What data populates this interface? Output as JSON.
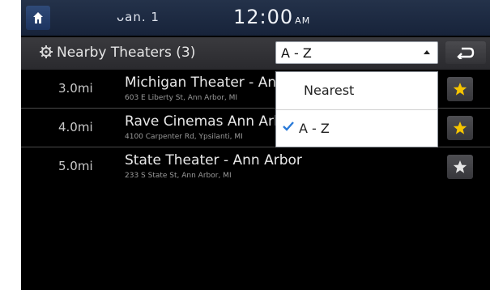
{
  "status_bar": {
    "signal_label": "ᴗan. 1",
    "clock": "12:00",
    "clock_ampm": "AM"
  },
  "title_bar": {
    "title": "Nearby Theaters (3)",
    "sort_selected": "A - Z"
  },
  "dropdown": {
    "options": [
      {
        "label": "Nearest",
        "selected": false
      },
      {
        "label": "A - Z",
        "selected": true
      }
    ]
  },
  "theaters": [
    {
      "distance": "3.0mi",
      "name": "Michigan Theater - Ann Arbor",
      "address": "603 E Liberty St, Ann Arbor, MI",
      "favorite": true
    },
    {
      "distance": "4.0mi",
      "name": "Rave Cinemas Ann Arbor",
      "address": "4100 Carpenter Rd, Ypsilanti, MI",
      "favorite": true
    },
    {
      "distance": "5.0mi",
      "name": "State Theater - Ann Arbor",
      "address": "233 S State St, Ann Arbor, MI",
      "favorite": false
    }
  ],
  "colors": {
    "star_on": "#f5c400",
    "star_off": "#e6e6e6",
    "check": "#2a7ad8"
  }
}
